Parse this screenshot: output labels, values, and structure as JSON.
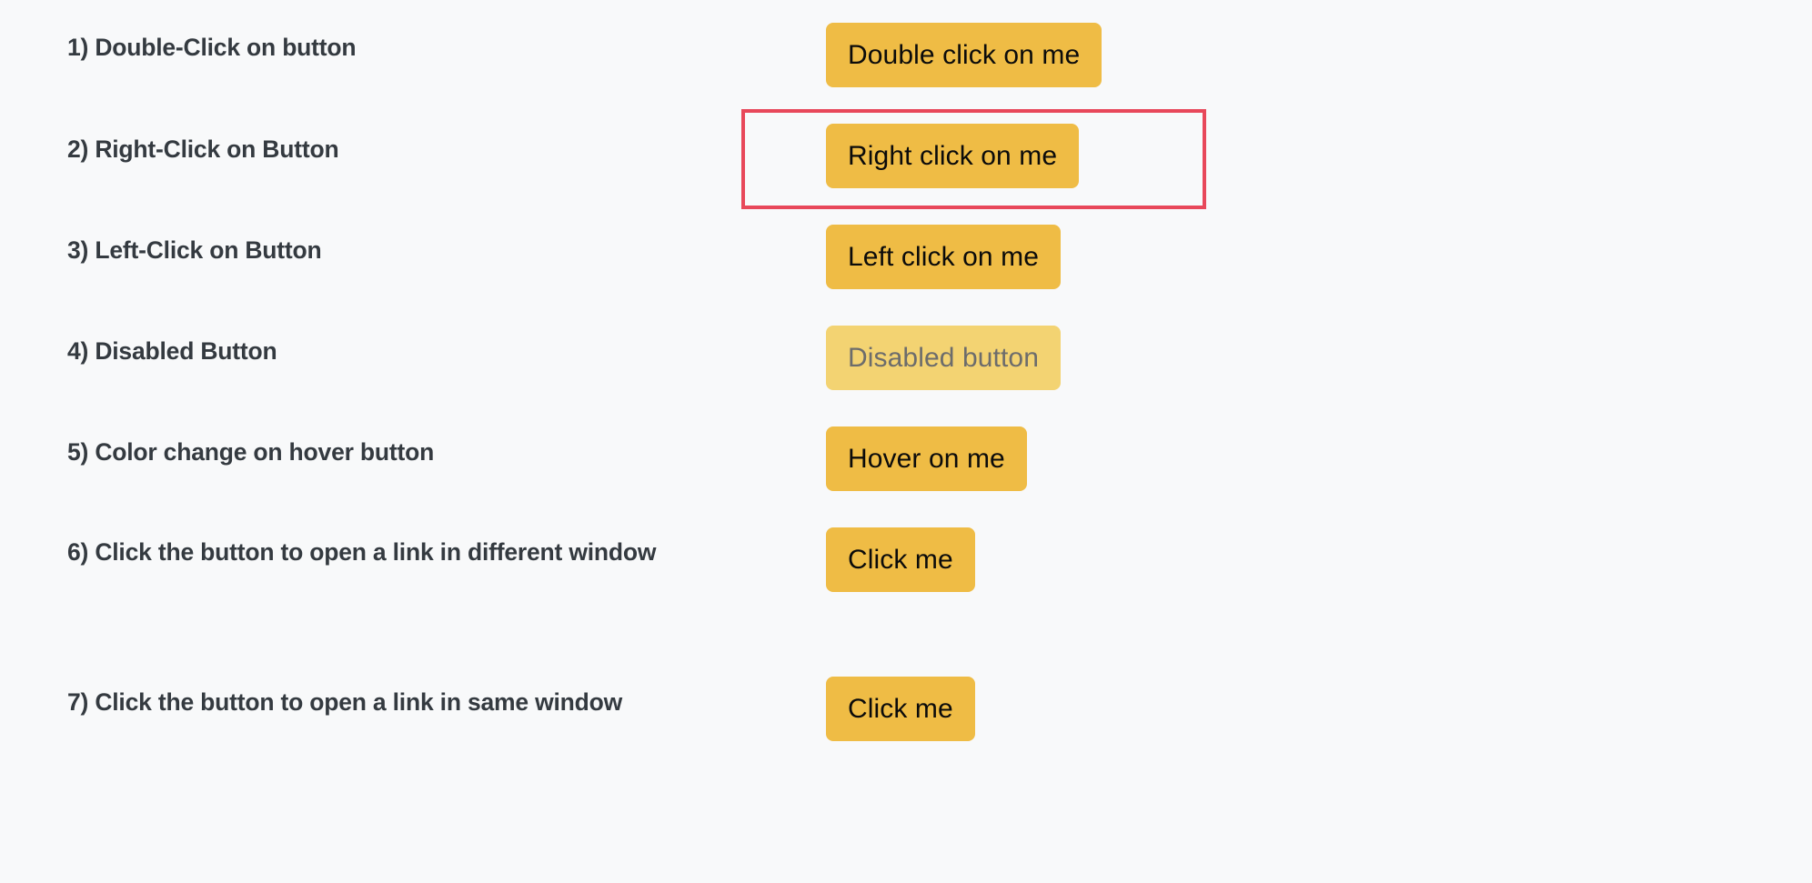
{
  "page": {
    "background_color": "#f8f9fa",
    "label_color": "#343a40",
    "button_color": "#efbc45",
    "button_text_color": "#0b0b0b",
    "disabled_button_color": "#f3d372",
    "disabled_button_text_color": "#6c6c6c",
    "highlight_color": "#e8485a"
  },
  "rows": [
    {
      "label": "1) Double-Click on button",
      "button_label": "Double click on me",
      "disabled": false,
      "highlighted": false
    },
    {
      "label": "2) Right-Click on Button",
      "button_label": "Right click on me",
      "disabled": false,
      "highlighted": true
    },
    {
      "label": "3) Left-Click on Button",
      "button_label": "Left click on me",
      "disabled": false,
      "highlighted": false
    },
    {
      "label": "4) Disabled Button",
      "button_label": "Disabled button",
      "disabled": true,
      "highlighted": false
    },
    {
      "label": "5) Color change on hover button",
      "button_label": "Hover on me",
      "disabled": false,
      "highlighted": false
    },
    {
      "label": "6) Click the button to open a link in different window",
      "button_label": "Click me",
      "disabled": false,
      "highlighted": false
    },
    {
      "label": "7) Click the button to open a link in same window",
      "button_label": "Click me",
      "disabled": false,
      "highlighted": false
    }
  ]
}
